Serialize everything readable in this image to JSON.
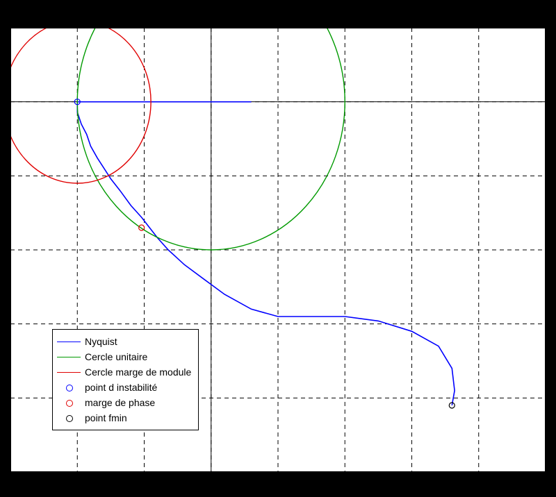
{
  "chart_data": {
    "type": "line",
    "title": "",
    "xlabel": "",
    "ylabel": "",
    "xlim": [
      -1.5,
      2.5
    ],
    "ylim": [
      -2.5,
      0.5
    ],
    "xticks": [
      -1.5,
      -1,
      -0.5,
      0,
      0.5,
      1,
      1.5,
      2,
      2.5
    ],
    "yticks": [
      -2.5,
      -2,
      -1.5,
      -1,
      -0.5,
      0,
      0.5
    ],
    "legend_position": "lower-left",
    "series": [
      {
        "name": "Nyquist",
        "type": "line",
        "color": "#0000ff",
        "x": [
          1.8,
          1.82,
          1.8,
          1.7,
          1.5,
          1.25,
          1.0,
          0.75,
          0.5,
          0.3,
          0.1,
          -0.05,
          -0.2,
          -0.32,
          -0.4,
          -0.46,
          -0.52,
          -0.6,
          -0.68,
          -0.75,
          -0.8,
          -0.85,
          -0.9,
          -0.93,
          -0.97,
          -1.0,
          -1.0,
          0.3
        ],
        "y": [
          -2.05,
          -1.95,
          -1.8,
          -1.65,
          -1.55,
          -1.48,
          -1.45,
          -1.45,
          -1.45,
          -1.4,
          -1.3,
          -1.2,
          -1.1,
          -1.0,
          -0.92,
          -0.85,
          -0.78,
          -0.7,
          -0.6,
          -0.52,
          -0.45,
          -0.38,
          -0.3,
          -0.22,
          -0.15,
          -0.07,
          0.0,
          0.0
        ]
      },
      {
        "name": "Cercle unitaire",
        "type": "circle",
        "color": "#009a00",
        "center_x": 0.0,
        "center_y": 0.0,
        "radius": 1.0
      },
      {
        "name": "Cercle marge de module",
        "type": "circle",
        "color": "#e00000",
        "center_x": -1.0,
        "center_y": 0.0,
        "radius": 0.55
      },
      {
        "name": "point d instabilité",
        "type": "marker",
        "color": "#0000ff",
        "x": -1.0,
        "y": 0.0
      },
      {
        "name": "marge de phase",
        "type": "marker",
        "color": "#e00000",
        "x": -0.52,
        "y": -0.85
      },
      {
        "name": "point fmin",
        "type": "marker",
        "color": "#000000",
        "x": 1.8,
        "y": -2.05
      }
    ]
  },
  "legend": {
    "items": [
      {
        "label": "Nyquist",
        "kind": "line",
        "color": "#0000ff"
      },
      {
        "label": "Cercle unitaire",
        "kind": "line",
        "color": "#009a00"
      },
      {
        "label": "Cercle marge de module",
        "kind": "line",
        "color": "#e00000"
      },
      {
        "label": "point d instabilité",
        "kind": "marker",
        "color": "#0000ff"
      },
      {
        "label": "marge de phase",
        "kind": "marker",
        "color": "#e00000"
      },
      {
        "label": "point fmin",
        "kind": "marker",
        "color": "#000000"
      }
    ]
  }
}
